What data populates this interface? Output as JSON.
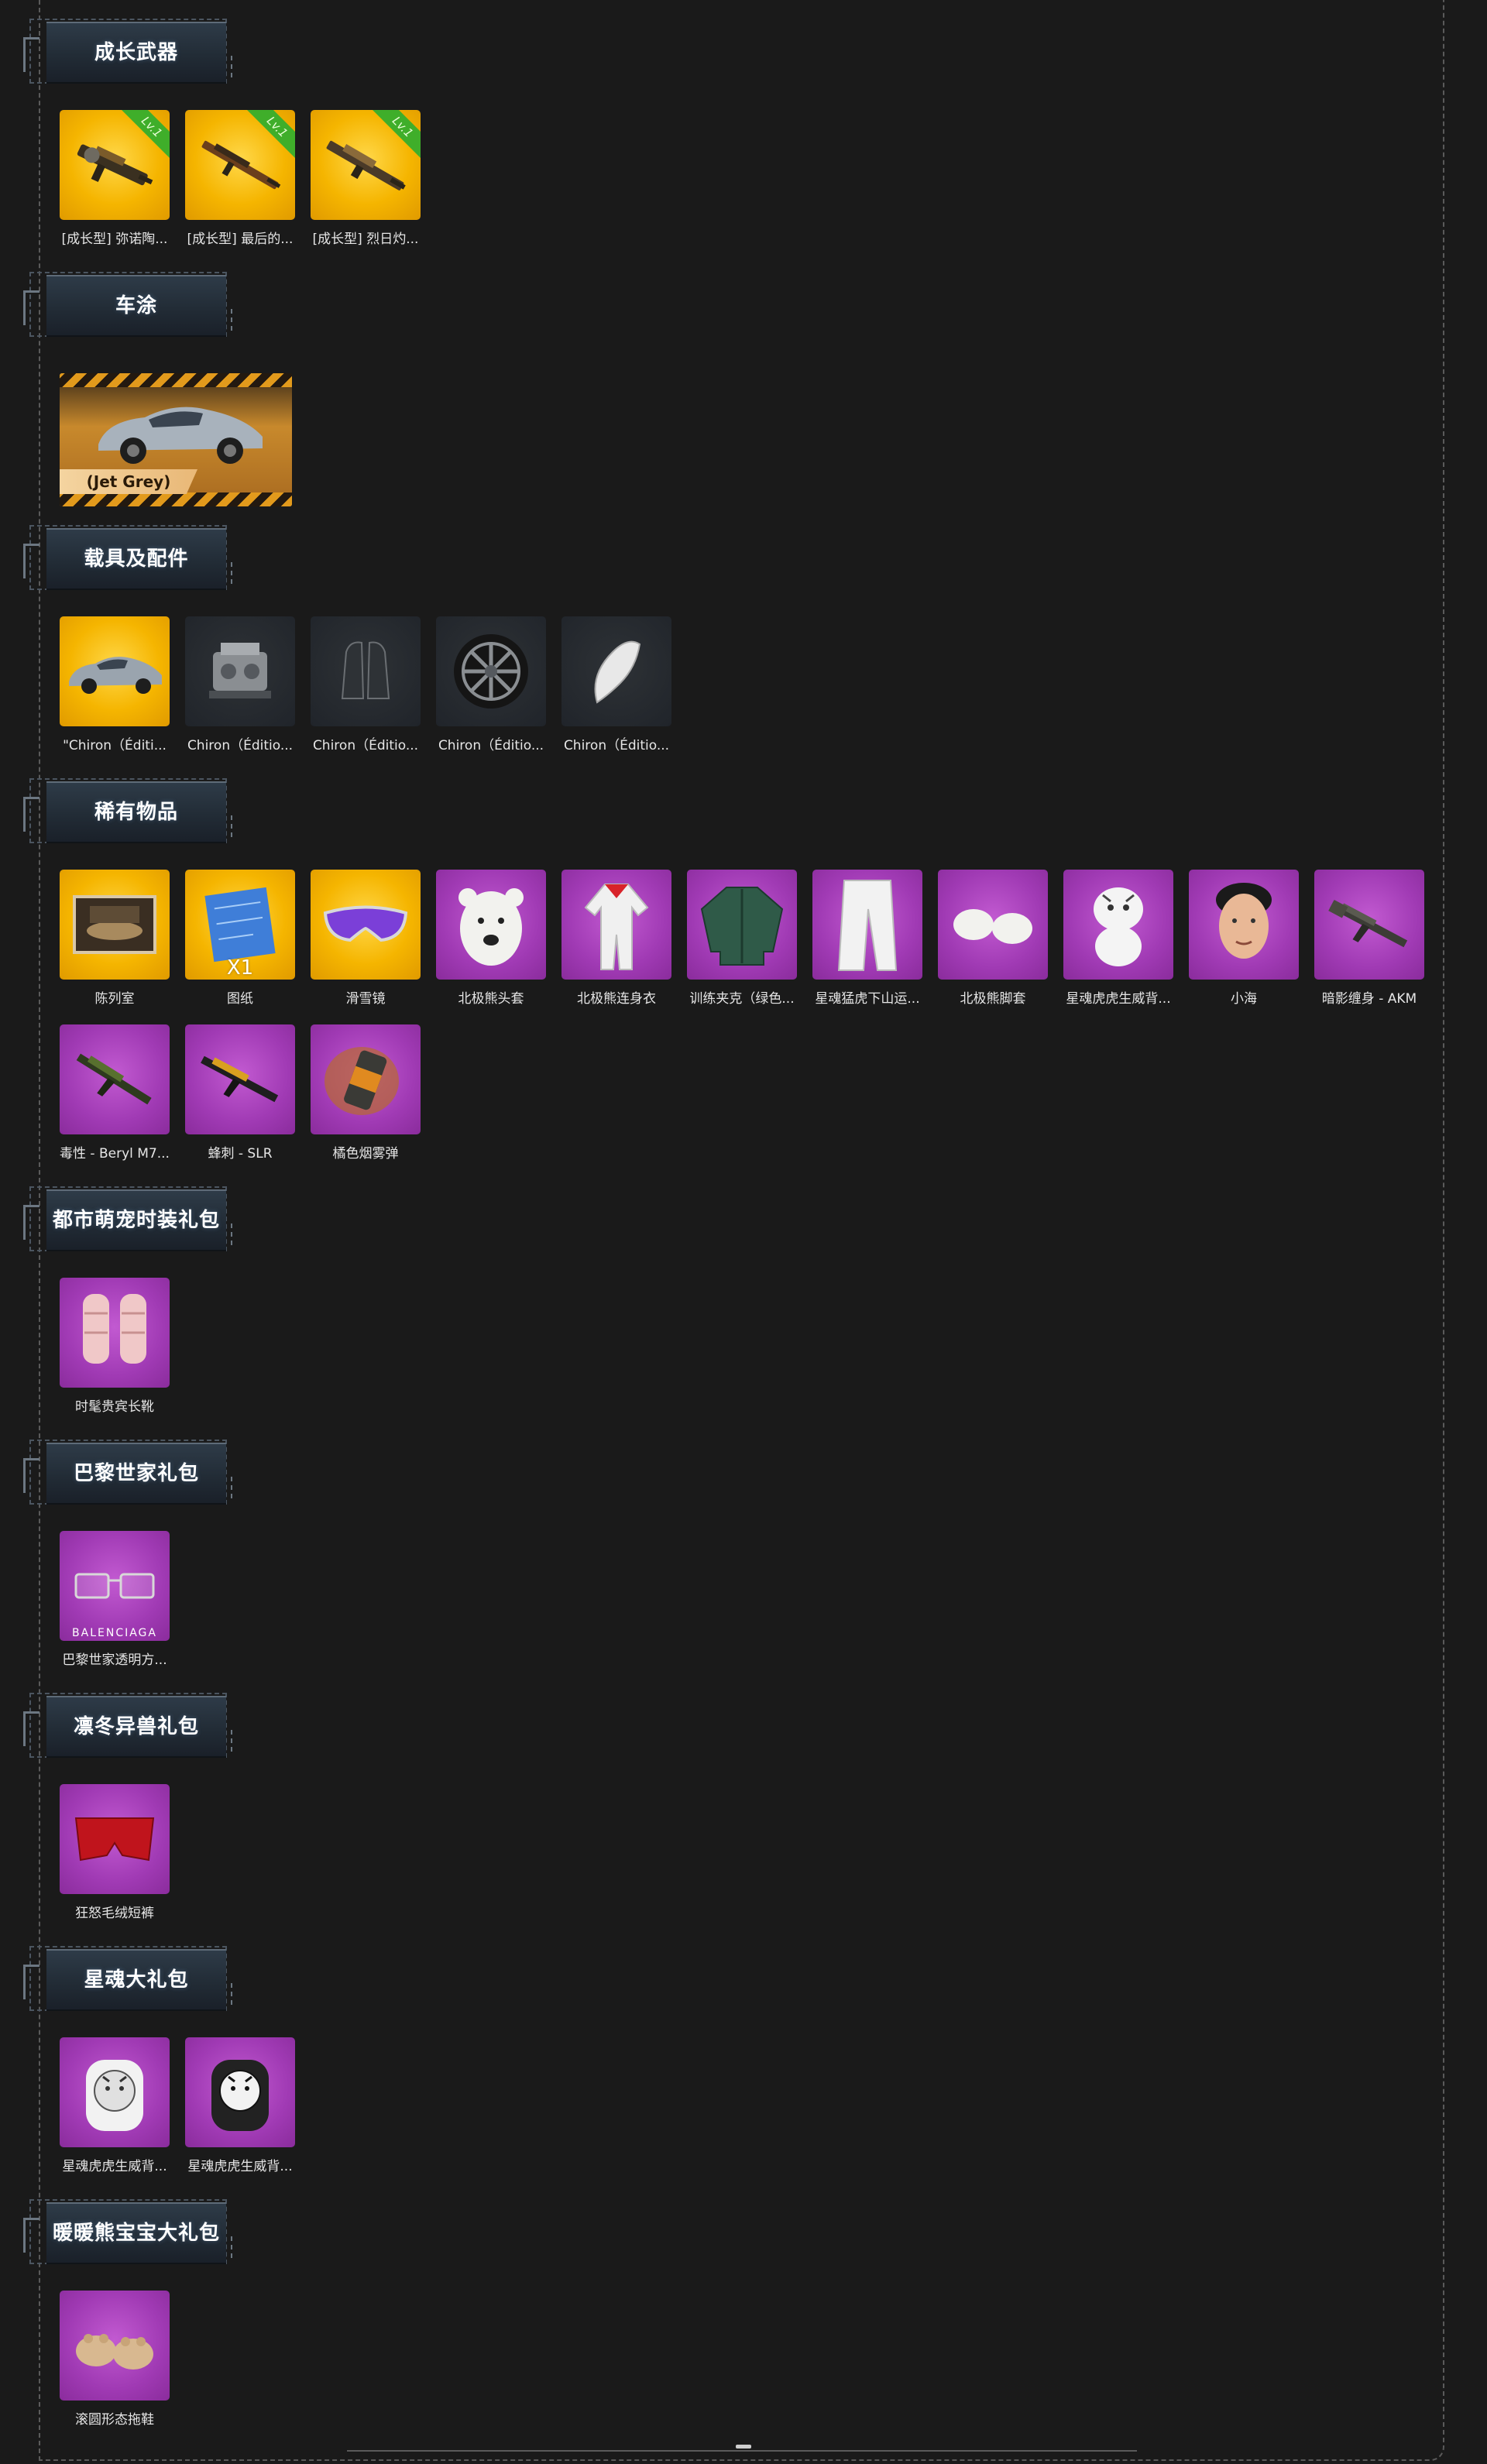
{
  "categories": [
    {
      "title": "成长武器",
      "items": [
        {
          "label": "[成长型] 弥诺陶...",
          "icon": "minotaur-rifle-icon",
          "rarity": "gold",
          "badge": "Lv.1"
        },
        {
          "label": "[成长型] 最后的...",
          "icon": "rifle-icon",
          "rarity": "gold",
          "badge": "Lv.1"
        },
        {
          "label": "[成长型] 烈日灼...",
          "icon": "shotgun-icon",
          "rarity": "gold",
          "badge": "Lv.1"
        }
      ]
    },
    {
      "title": "车涂",
      "skin": {
        "label": "(Jet Grey)",
        "icon": "car-icon"
      }
    },
    {
      "title": "载具及配件",
      "items": [
        {
          "label": "\"Chiron（Éditi...",
          "icon": "car-icon",
          "rarity": "gold"
        },
        {
          "label": "Chiron（Éditio...",
          "icon": "engine-icon",
          "rarity": "dark"
        },
        {
          "label": "Chiron（Éditio...",
          "icon": "seat-icon",
          "rarity": "dark"
        },
        {
          "label": "Chiron（Éditio...",
          "icon": "wheel-icon",
          "rarity": "dark"
        },
        {
          "label": "Chiron（Éditio...",
          "icon": "bumper-icon",
          "rarity": "dark"
        }
      ]
    },
    {
      "title": "稀有物品",
      "items": [
        {
          "label": "陈列室",
          "icon": "showroom-icon",
          "rarity": "gold"
        },
        {
          "label": "图纸",
          "icon": "blueprint-icon",
          "rarity": "gold",
          "qty": "X1"
        },
        {
          "label": "滑雪镜",
          "icon": "goggles-icon",
          "rarity": "gold"
        },
        {
          "label": "北极熊头套",
          "icon": "bear-head-icon",
          "rarity": "purple"
        },
        {
          "label": "北极熊连身衣",
          "icon": "jumpsuit-icon",
          "rarity": "purple"
        },
        {
          "label": "训练夹克（绿色...",
          "icon": "jacket-icon",
          "rarity": "purple"
        },
        {
          "label": "星魂猛虎下山运...",
          "icon": "pants-icon",
          "rarity": "purple"
        },
        {
          "label": "北极熊脚套",
          "icon": "bear-feet-icon",
          "rarity": "purple"
        },
        {
          "label": "星魂虎虎生威背...",
          "icon": "tiger-plush-icon",
          "rarity": "purple"
        },
        {
          "label": "小海",
          "icon": "portrait-icon",
          "rarity": "purple"
        },
        {
          "label": "暗影缠身 - AKM",
          "icon": "akm-icon",
          "rarity": "purple"
        },
        {
          "label": "毒性 - Beryl M7...",
          "icon": "beryl-icon",
          "rarity": "purple"
        },
        {
          "label": "蜂刺 - SLR",
          "icon": "slr-icon",
          "rarity": "purple"
        },
        {
          "label": "橘色烟雾弹",
          "icon": "smoke-grenade-icon",
          "rarity": "purple"
        }
      ]
    },
    {
      "title": "都市萌宠时装礼包",
      "items": [
        {
          "label": "时髦贵宾长靴",
          "icon": "boots-icon",
          "rarity": "purple"
        }
      ]
    },
    {
      "title": "巴黎世家礼包",
      "items": [
        {
          "label": "巴黎世家透明方...",
          "icon": "glasses-icon",
          "rarity": "purple",
          "brand": "BALENCIAGA"
        }
      ]
    },
    {
      "title": "凛冬异兽礼包",
      "items": [
        {
          "label": "狂怒毛绒短裤",
          "icon": "shorts-icon",
          "rarity": "purple"
        }
      ]
    },
    {
      "title": "星魂大礼包",
      "items": [
        {
          "label": "星魂虎虎生威背...",
          "icon": "tiger-backpack-white-icon",
          "rarity": "purple"
        },
        {
          "label": "星魂虎虎生威背...",
          "icon": "tiger-backpack-black-icon",
          "rarity": "purple"
        }
      ]
    },
    {
      "title": "暖暖熊宝宝大礼包",
      "items": [
        {
          "label": "滚圆形态拖鞋",
          "icon": "slippers-icon",
          "rarity": "purple"
        }
      ]
    }
  ]
}
